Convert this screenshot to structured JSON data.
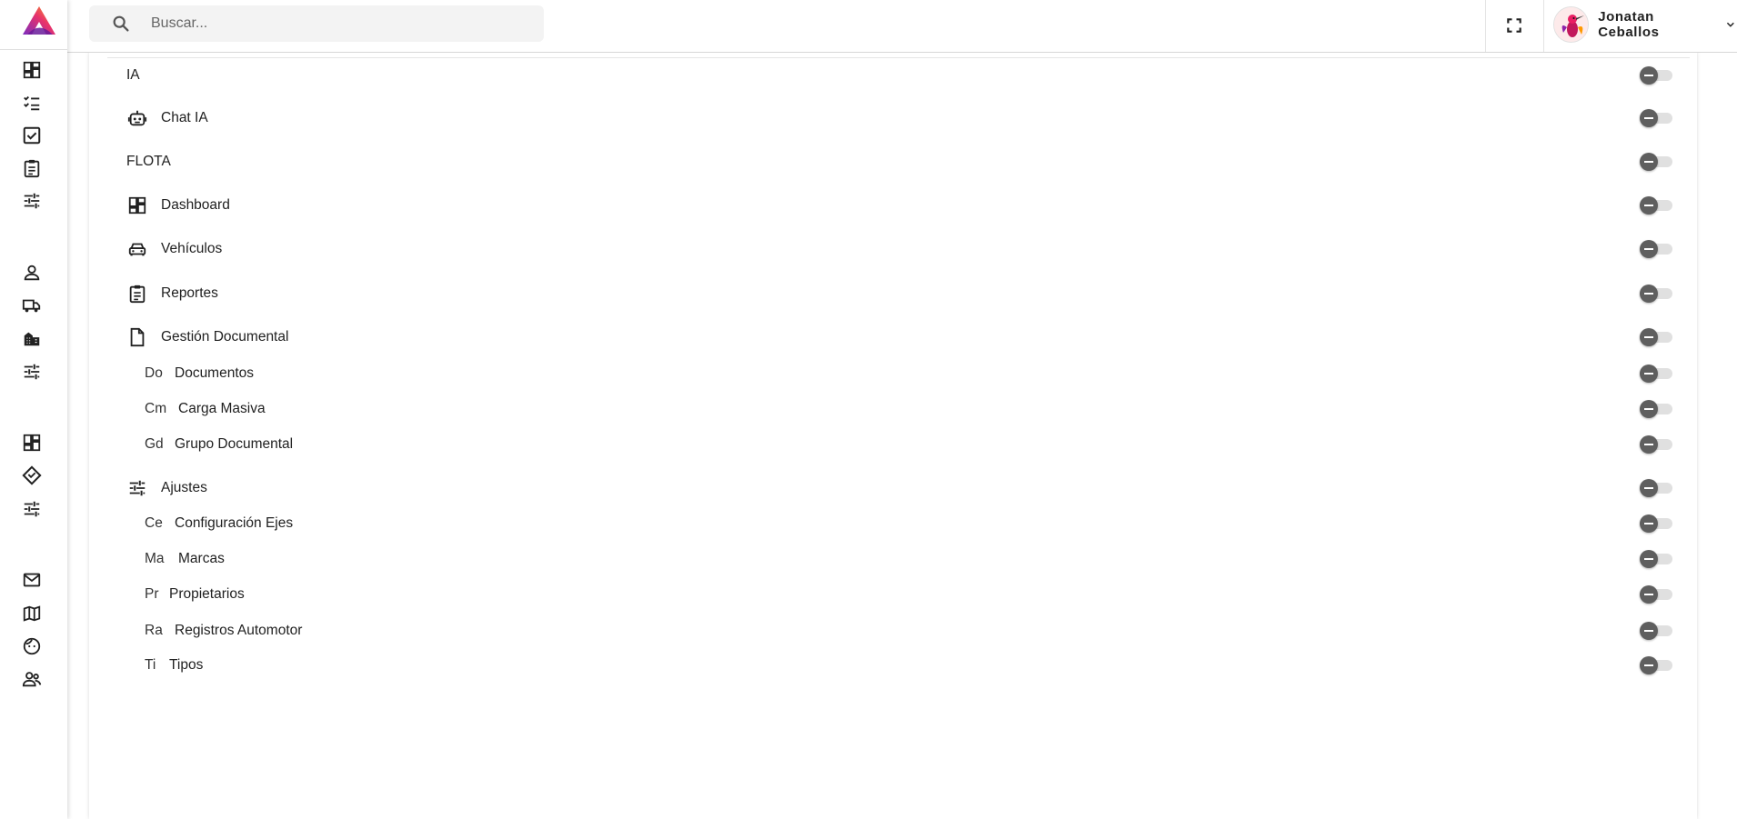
{
  "header": {
    "search_placeholder": "Buscar...",
    "user_name": "Jonatan Ceballos"
  },
  "sidebar": {
    "icons": [
      "dashboard-icon",
      "checklist-icon",
      "checkbox-icon",
      "clipboard-icon",
      "tune-icon",
      "person-icon",
      "truck-icon",
      "building-icon",
      "tune-icon",
      "dashboard-icon",
      "tag-icon",
      "tune-icon",
      "mail-icon",
      "map-icon",
      "face-icon",
      "group-icon"
    ]
  },
  "permissions": [
    {
      "label": "IA",
      "abbr": "",
      "icon": "",
      "enabled": false
    },
    {
      "label": "Chat IA",
      "abbr": "",
      "icon": "robot-icon",
      "enabled": false
    },
    {
      "label": "FLOTA",
      "abbr": "",
      "icon": "",
      "enabled": false
    },
    {
      "label": "Dashboard",
      "abbr": "",
      "icon": "dashboard-icon",
      "enabled": false
    },
    {
      "label": "Vehículos",
      "abbr": "",
      "icon": "car-icon",
      "enabled": false
    },
    {
      "label": "Reportes",
      "abbr": "",
      "icon": "clipboard-icon",
      "enabled": false
    },
    {
      "label": "Gestión Documental",
      "abbr": "",
      "icon": "document-icon",
      "enabled": false
    },
    {
      "label": "Documentos",
      "abbr": "Do",
      "icon": "",
      "enabled": false
    },
    {
      "label": "Carga Masiva",
      "abbr": "Cm",
      "icon": "",
      "enabled": false
    },
    {
      "label": "Grupo Documental",
      "abbr": "Gd",
      "icon": "",
      "enabled": false
    },
    {
      "label": "Ajustes",
      "abbr": "",
      "icon": "tune-icon",
      "enabled": false
    },
    {
      "label": "Configuración Ejes",
      "abbr": "Ce",
      "icon": "",
      "enabled": false
    },
    {
      "label": "Marcas",
      "abbr": "Ma",
      "icon": "",
      "enabled": false
    },
    {
      "label": "Propietarios",
      "abbr": "Pr",
      "icon": "",
      "enabled": false
    },
    {
      "label": "Registros Automotor",
      "abbr": "Ra",
      "icon": "",
      "enabled": false
    },
    {
      "label": "Tipos",
      "abbr": "Ti",
      "icon": "",
      "enabled": false
    }
  ]
}
